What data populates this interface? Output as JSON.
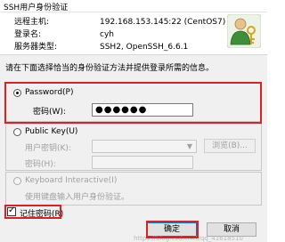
{
  "window": {
    "title": "SSH用户身份验证"
  },
  "host_info": {
    "remote_host_label": "远程主机:",
    "remote_host_value": "192.168.153.145:22 (CentOS7)",
    "login_name_label": "登录名:",
    "login_name_value": "cyh",
    "server_type_label": "服务器类型:",
    "server_type_value": "SSH2, OpenSSH_6.6.1"
  },
  "instruction": "请在下面选择恰当的身份验证方法并提供登录所需的信息。",
  "password_option": {
    "label": "Password(P)",
    "selected": true,
    "field_label": "密码(W):",
    "field_value": "●●●●●●"
  },
  "public_key_option": {
    "label": "Public Key(U)",
    "selected": false,
    "user_key_label": "用户密钥(K):",
    "browse_label": "浏览(B)...",
    "passphrase_label": "密码(H):"
  },
  "keyboard_option": {
    "label": "Keyboard Interactive(I)",
    "selected": false,
    "description": "使用键盘输入用户身份验证。"
  },
  "remember_password": {
    "label": "记住密码(R)",
    "checked": true
  },
  "buttons": {
    "ok": "确定",
    "cancel": "取消"
  },
  "watermark": "https://blog.csdn.net/qq_41618510",
  "colors": {
    "highlight_box": "#e02020",
    "dialog_bg": "#f0f0f0"
  },
  "icons": {
    "logo": "keys-user-icon",
    "dropdown": "chevron-down-icon"
  }
}
